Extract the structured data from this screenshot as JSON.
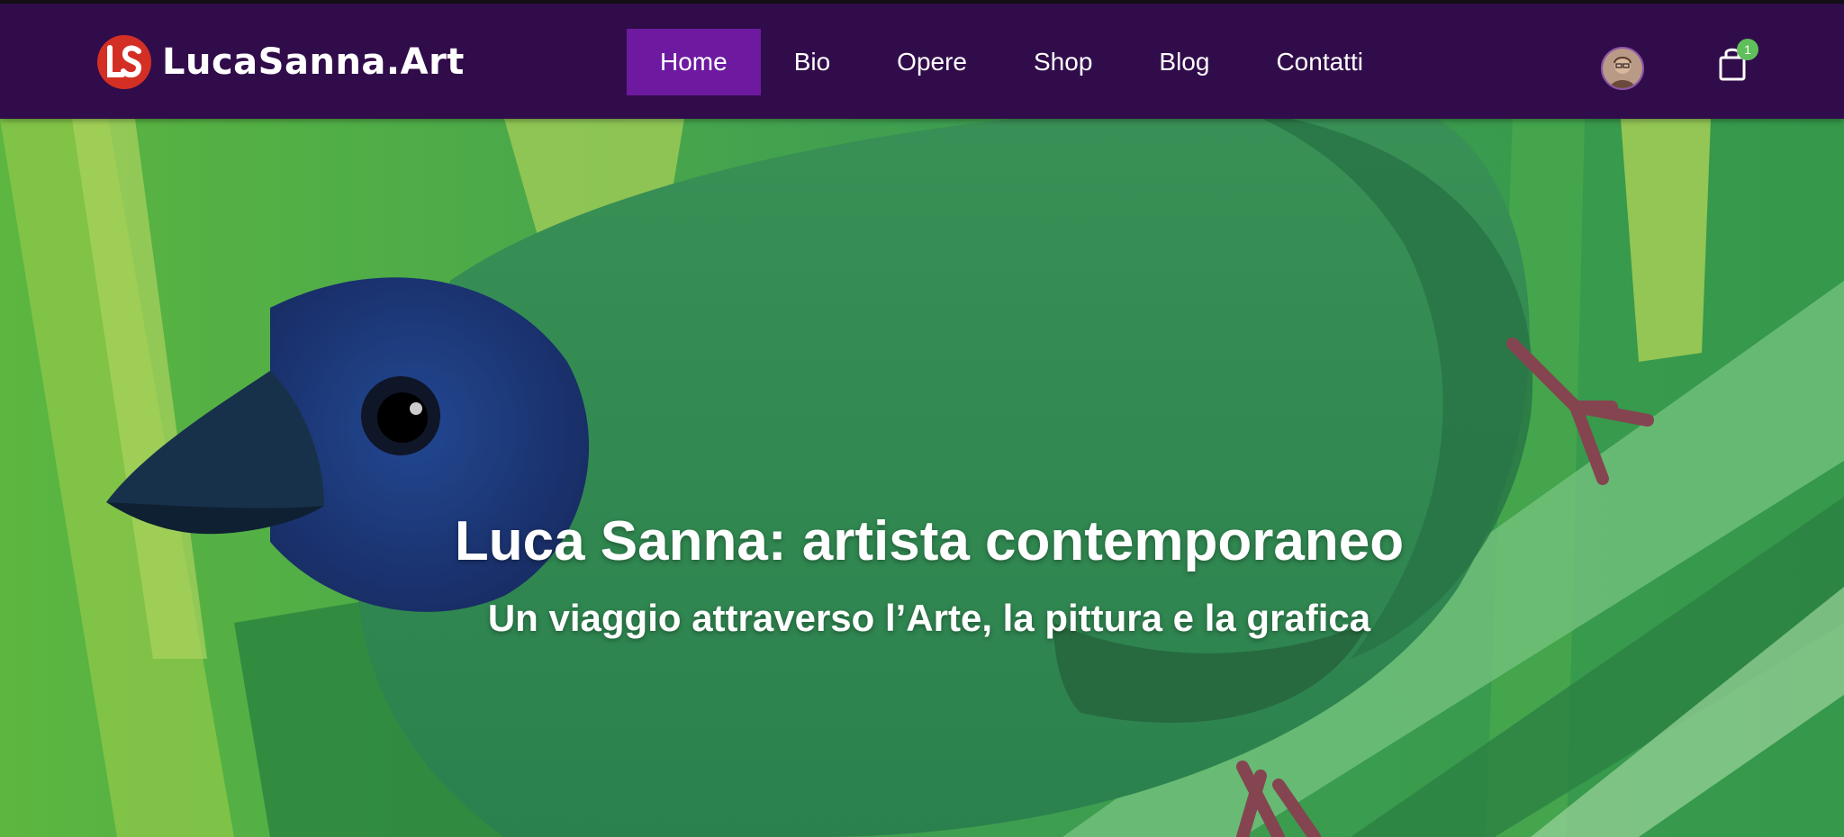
{
  "brand": {
    "logo_initials": "LS",
    "name": "LucaSanna.Art",
    "accent_color": "#d42f25"
  },
  "nav": {
    "background_color": "#310c4a",
    "active_color": "#6d1aa0",
    "items": [
      {
        "label": "Home",
        "active": true
      },
      {
        "label": "Bio",
        "active": false
      },
      {
        "label": "Opere",
        "active": false
      },
      {
        "label": "Shop",
        "active": false
      },
      {
        "label": "Blog",
        "active": false
      },
      {
        "label": "Contatti",
        "active": false
      }
    ]
  },
  "header_icons": {
    "avatar": "user-avatar-icon",
    "cart": "shopping-bag-icon",
    "cart_count": "1"
  },
  "hero": {
    "title": "Luca Sanna: artista contemporaneo",
    "subtitle": "Un viaggio attraverso l’Arte, la pittura e la grafica"
  }
}
